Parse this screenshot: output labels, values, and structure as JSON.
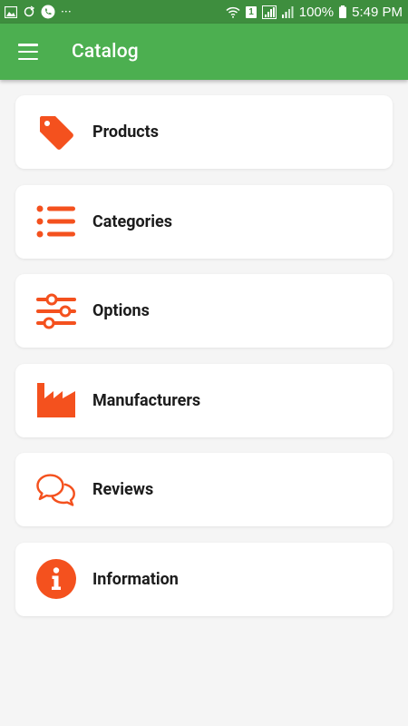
{
  "status_bar": {
    "battery": "100%",
    "time": "5:49 PM",
    "sim": "1",
    "more": "···"
  },
  "app_bar": {
    "title": "Catalog"
  },
  "accent_color": "#f4511e",
  "items": [
    {
      "label": "Products",
      "icon": "tag-icon"
    },
    {
      "label": "Categories",
      "icon": "list-icon"
    },
    {
      "label": "Options",
      "icon": "sliders-icon"
    },
    {
      "label": "Manufacturers",
      "icon": "factory-icon"
    },
    {
      "label": "Reviews",
      "icon": "chat-bubbles-icon"
    },
    {
      "label": "Information",
      "icon": "info-icon"
    }
  ]
}
